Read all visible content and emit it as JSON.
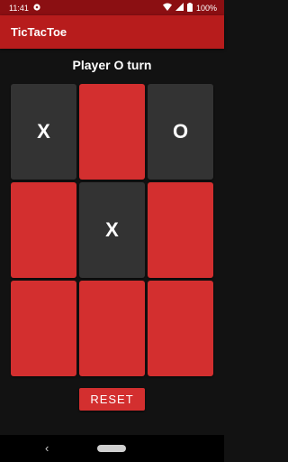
{
  "status_bar": {
    "time": "11:41",
    "app_icon": "notification-app-icon",
    "icons": [
      "wifi-icon",
      "signal-icon",
      "battery-icon"
    ],
    "battery": "100%",
    "color": "#8b0f12"
  },
  "app_bar": {
    "title": "TicTacToe",
    "color": "#b71c1c"
  },
  "game": {
    "turn_text": "Player O turn",
    "board": [
      {
        "mark": "X",
        "state": "dark"
      },
      {
        "mark": "",
        "state": "red"
      },
      {
        "mark": "O",
        "state": "dark"
      },
      {
        "mark": "",
        "state": "red"
      },
      {
        "mark": "X",
        "state": "dark"
      },
      {
        "mark": "",
        "state": "red"
      },
      {
        "mark": "",
        "state": "red"
      },
      {
        "mark": "",
        "state": "red"
      },
      {
        "mark": "",
        "state": "red"
      }
    ],
    "colors": {
      "empty_cell": "#d32f2f",
      "filled_cell": "#333333"
    }
  },
  "reset_button": {
    "label": "RESET"
  },
  "nav_bar": {
    "back_icon": "‹"
  }
}
